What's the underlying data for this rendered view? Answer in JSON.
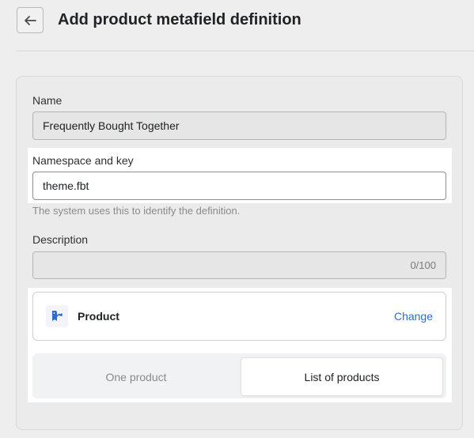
{
  "header": {
    "title": "Add product metafield definition",
    "back_icon": "arrow-left-icon"
  },
  "form": {
    "name": {
      "label": "Name",
      "value": "Frequently Bought Together"
    },
    "namespace": {
      "label": "Namespace and key",
      "value": "theme.fbt",
      "help": "The system uses this to identify the definition."
    },
    "description": {
      "label": "Description",
      "value": "",
      "counter": "0/100"
    }
  },
  "type": {
    "icon": "product-icon",
    "name": "Product",
    "change_label": "Change"
  },
  "cardinality": {
    "options": [
      "One product",
      "List of products"
    ],
    "selected": "List of products"
  },
  "colors": {
    "accent": "#2c6ecb",
    "background": "#eeeeee"
  }
}
